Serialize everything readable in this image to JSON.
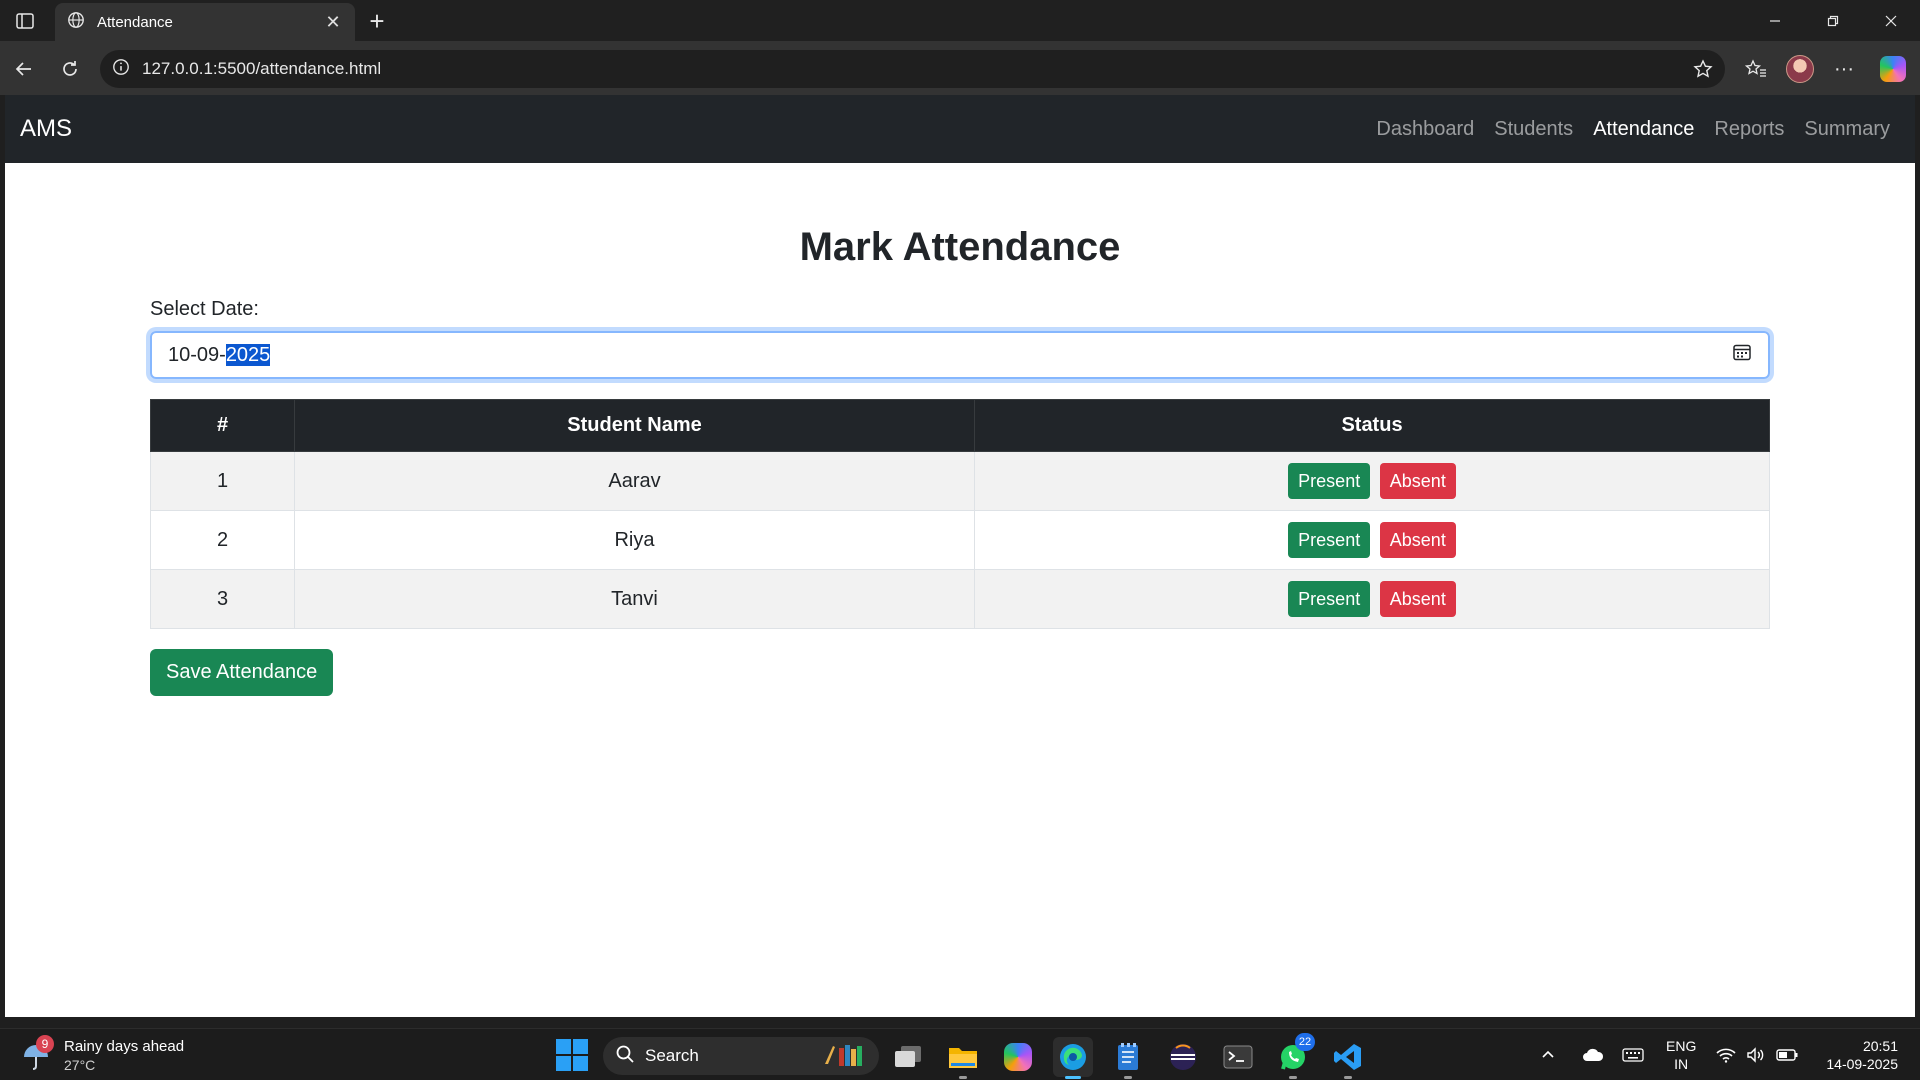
{
  "browser": {
    "tab_title": "Attendance",
    "url": "127.0.0.1:5500/attendance.html"
  },
  "navbar": {
    "brand": "AMS",
    "links": [
      {
        "label": "Dashboard",
        "active": false
      },
      {
        "label": "Students",
        "active": false
      },
      {
        "label": "Attendance",
        "active": true
      },
      {
        "label": "Reports",
        "active": false
      },
      {
        "label": "Summary",
        "active": false
      }
    ]
  },
  "main": {
    "heading": "Mark Attendance",
    "date_label": "Select Date:",
    "date_value_prefix": "10-09-",
    "date_value_selected": "2025",
    "table": {
      "headers": [
        "#",
        "Student Name",
        "Status"
      ],
      "rows": [
        {
          "num": "1",
          "name": "Aarav"
        },
        {
          "num": "2",
          "name": "Riya"
        },
        {
          "num": "3",
          "name": "Tanvi"
        }
      ],
      "present_label": "Present",
      "absent_label": "Absent"
    },
    "save_label": "Save Attendance"
  },
  "taskbar": {
    "weather_badge": "9",
    "weather_text": "Rainy days ahead",
    "weather_temp": "27°C",
    "search_placeholder": "Search",
    "whatsapp_badge": "22",
    "lang_line1": "ENG",
    "lang_line2": "IN",
    "time": "20:51",
    "date": "14-09-2025"
  },
  "colors": {
    "navbar_bg": "#212529",
    "success": "#198754",
    "danger": "#dc3545",
    "focus_border": "#86b7fe"
  }
}
